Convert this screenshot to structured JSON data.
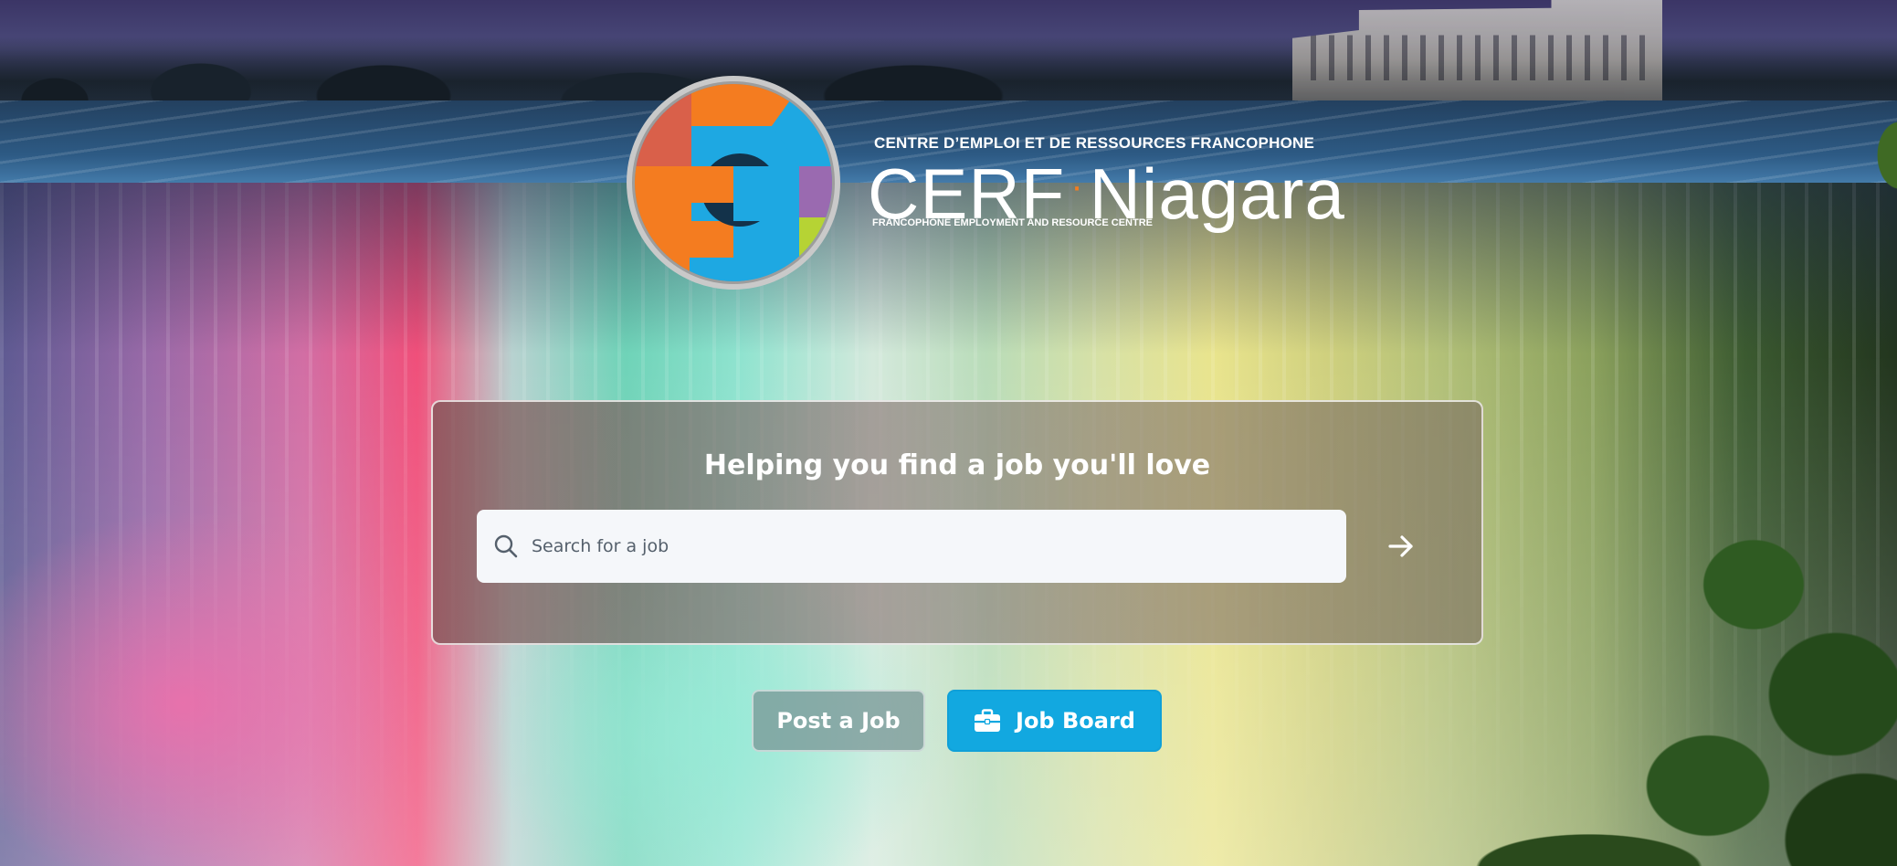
{
  "logo": {
    "top_line": "CENTRE D’EMPLOI ET DE RESSOURCES FRANCOPHONE",
    "name_part1": "CERF",
    "separator": "·",
    "name_part2": "Niagara",
    "bottom_line": "FRANCOPHONE EMPLOYMENT AND RESOURCE CENTRE",
    "colors": {
      "orange": "#f47c20",
      "red": "#d9604a",
      "blue": "#1ea8e2",
      "purple": "#9a6ab0",
      "green": "#b6d334",
      "ring": "#c9c9c9"
    }
  },
  "search": {
    "heading": "Helping you find a job you'll love",
    "placeholder": "Search for a job",
    "value": "",
    "icon": "search-icon",
    "submit_icon": "arrow-right-icon"
  },
  "buttons": {
    "post_job": "Post a Job",
    "job_board": "Job Board",
    "job_board_icon": "briefcase-icon"
  },
  "colors": {
    "accent": "#12a8e0",
    "post_button_bg": "#78969695"
  }
}
